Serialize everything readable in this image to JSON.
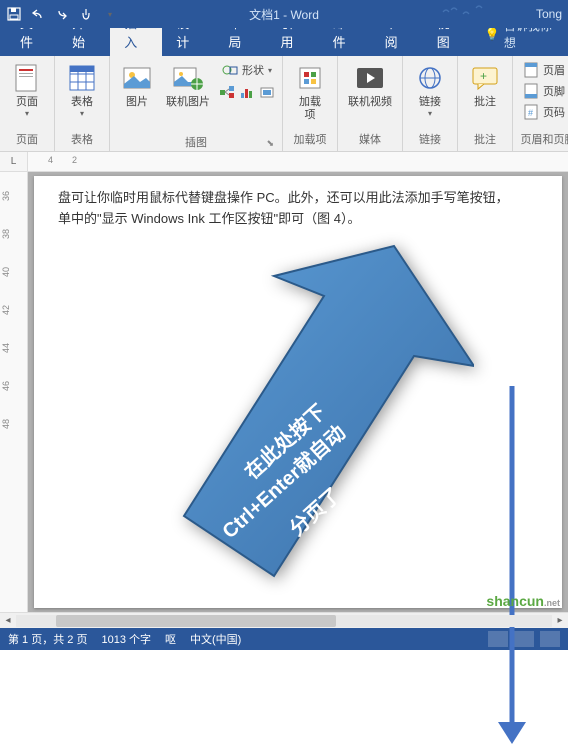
{
  "titlebar": {
    "title": "文档1 - Word",
    "user": "Tong"
  },
  "tabs": {
    "file": "文件",
    "home": "开始",
    "insert": "插入",
    "design": "设计",
    "layout": "布局",
    "references": "引用",
    "mailings": "邮件",
    "review": "审阅",
    "view": "视图",
    "tellme": "告诉我你想"
  },
  "ribbon": {
    "pages": {
      "label": "页面",
      "btn": "页面"
    },
    "tables": {
      "label": "表格",
      "btn": "表格"
    },
    "illustrations": {
      "label": "插图",
      "pictures": "图片",
      "online_pictures": "联机图片",
      "shapes": "形状"
    },
    "addins": {
      "label": "加载项",
      "btn": "加载\n项"
    },
    "media": {
      "label": "媒体",
      "video": "联机视频"
    },
    "links": {
      "label": "链接",
      "btn": "链接"
    },
    "comments": {
      "label": "批注",
      "btn": "批注"
    },
    "header_footer": {
      "label": "页眉和页脚",
      "header": "页眉",
      "footer": "页脚",
      "page_number": "页码"
    }
  },
  "ruler": {
    "h": {
      "m2": "2",
      "m4": "4"
    },
    "v": [
      "36",
      "38",
      "40",
      "42",
      "44",
      "46",
      "48"
    ]
  },
  "document": {
    "line1": "盘可让你临时用鼠标代替键盘操作 PC。此外，还可以用此法添加手写笔按钮，",
    "line2": "单中的\"显示 Windows Ink 工作区按钮\"即可（图 4）。"
  },
  "annotation": {
    "line1": "在此处按下",
    "line2": "Ctrl+Enter就自动",
    "line3": "分页了"
  },
  "statusbar": {
    "page": "第 1 页，共 2 页",
    "words": "1013 个字",
    "language": "中文(中国)",
    "proofing": "呕"
  },
  "watermark": {
    "text": "shancun",
    "suffix": ".net"
  }
}
